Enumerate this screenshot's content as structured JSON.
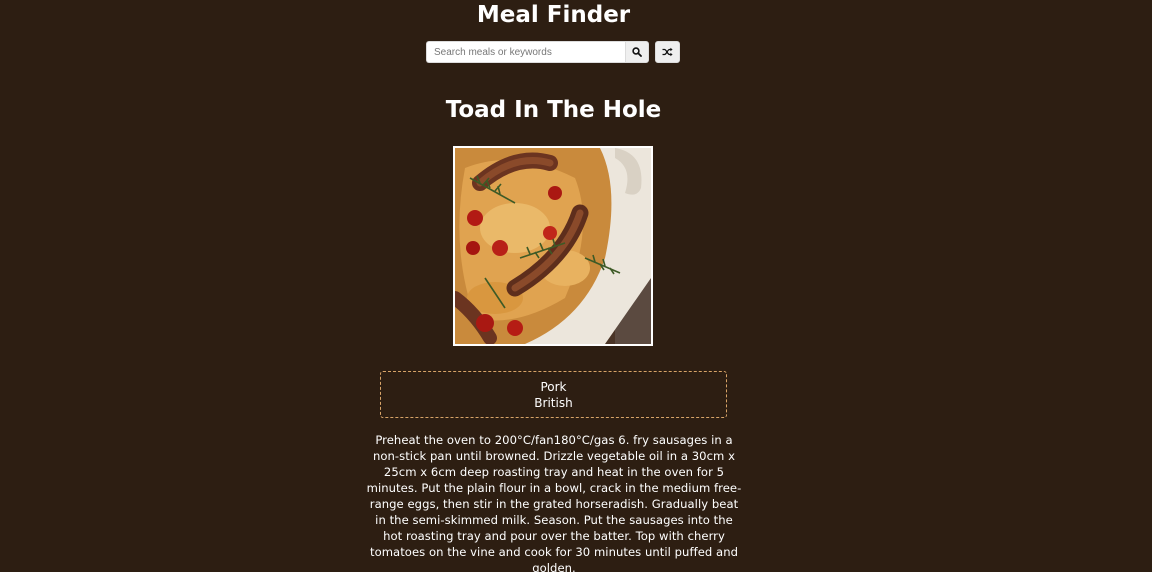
{
  "header": {
    "title": "Meal Finder"
  },
  "search": {
    "placeholder": "Search meals or keywords",
    "value": "",
    "search_button_icon": "search-icon",
    "random_button_icon": "shuffle-icon"
  },
  "meal": {
    "title": "Toad In The Hole",
    "image_alt": "Toad In The Hole",
    "category": "Pork",
    "area": "British",
    "instructions": "Preheat the oven to 200°C/fan180°C/gas 6. fry sausages in a non-stick pan until browned. Drizzle vegetable oil in a 30cm x 25cm x 6cm deep roasting tray and heat in the oven for 5 minutes. Put the plain flour in a bowl, crack in the medium free-range eggs, then stir in the grated horseradish. Gradually beat in the semi-skimmed milk. Season. Put the sausages into the hot roasting tray and pour over the batter. Top with cherry tomatoes on the vine and cook for 30 minutes until puffed and golden."
  },
  "colors": {
    "background": "#2d1e12",
    "text": "#ffffff",
    "info_border": "#d8a468"
  }
}
